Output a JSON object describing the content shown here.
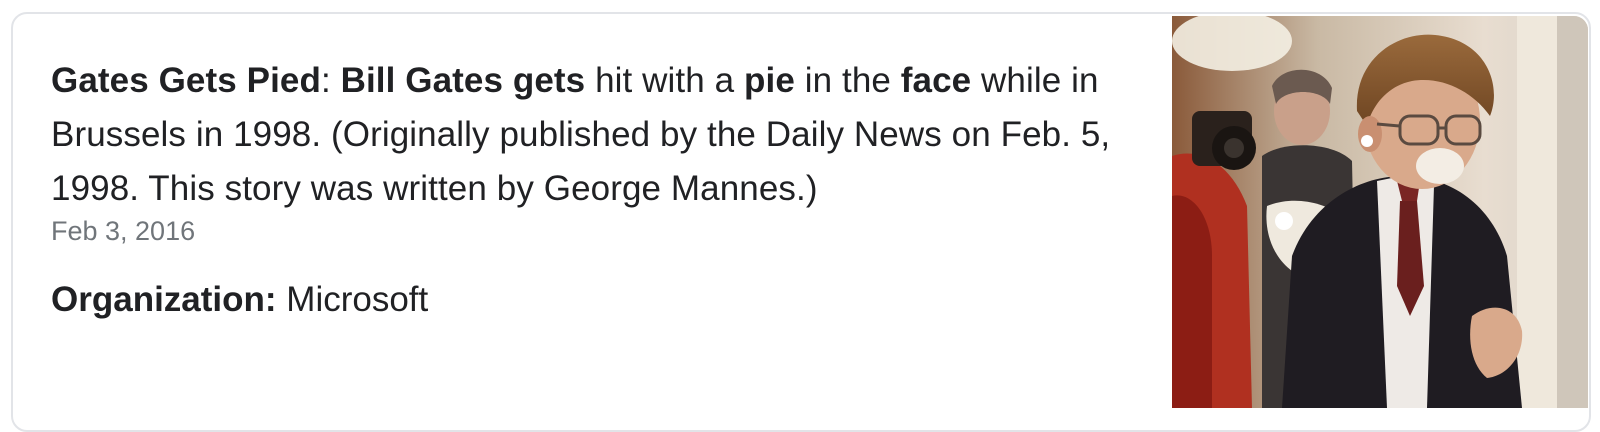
{
  "snippet": {
    "title_bold": "Gates Gets Pied",
    "sep": ": ",
    "b1": "Bill Gates gets",
    "t1": " hit with a ",
    "b2": "pie",
    "t2": " in the ",
    "b3": "face",
    "t3": " while in Brussels in 1998. (Originally published by the Daily News on Feb. 5, 1998. This story was written by George Mannes.)"
  },
  "date": "Feb 3, 2016",
  "organization": {
    "label": "Organization:",
    "value": " Microsoft"
  },
  "image": {
    "icon": "photo-thumbnail"
  }
}
